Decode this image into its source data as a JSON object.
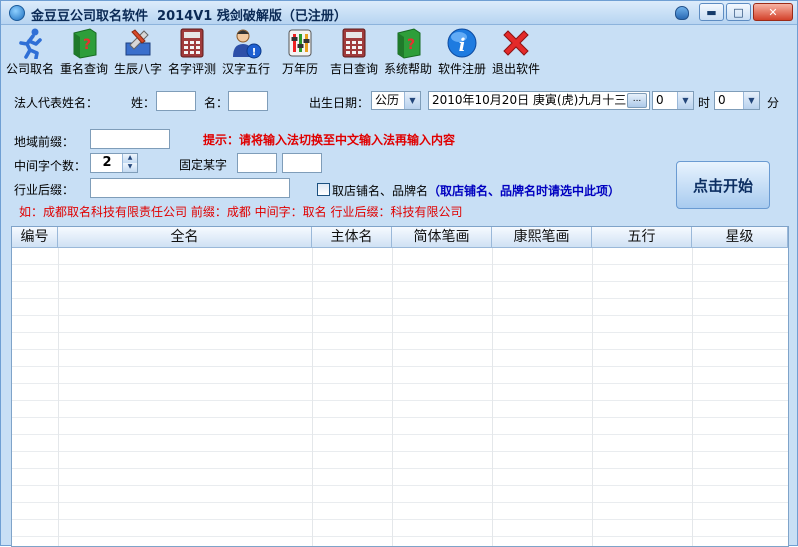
{
  "window": {
    "title": "金豆豆公司取名软件  2014V1 残剑破解版（已注册）",
    "controls": {
      "minimize": "▬",
      "maximize": "□",
      "close": "✕"
    }
  },
  "toolbar": {
    "items": [
      {
        "label": "公司取名",
        "icon": "runner-icon"
      },
      {
        "label": "重名查询",
        "icon": "green-book-icon"
      },
      {
        "label": "生辰八字",
        "icon": "tools-icon"
      },
      {
        "label": "名字评测",
        "icon": "calculator-icon"
      },
      {
        "label": "汉字五行",
        "icon": "person-info-icon"
      },
      {
        "label": "万年历",
        "icon": "calendar-sliders-icon"
      },
      {
        "label": "吉日查询",
        "icon": "calculator-icon"
      },
      {
        "label": "系统帮助",
        "icon": "help-book-icon"
      },
      {
        "label": "软件注册",
        "icon": "info-icon"
      },
      {
        "label": "退出软件",
        "icon": "red-x-icon"
      }
    ]
  },
  "form": {
    "legal_rep_label": "法人代表姓名：",
    "surname_label": "姓：",
    "surname_value": "",
    "given_label": "名：",
    "given_value": "",
    "birth_label": "出生日期：",
    "calendar_type": "公历",
    "birth_date": "2010年10月20日 庚寅(虎)九月十三",
    "dots": "...",
    "hour_value": "0",
    "hour_label": "时",
    "minute_value": "0",
    "minute_label": "分",
    "region_prefix_label": "地域前缀：",
    "region_prefix_value": "",
    "hint": "提示：请将输入法切换至中文输入法再输入内容",
    "middle_count_label": "中间字个数：",
    "middle_count_value": "2",
    "fixed_char_label": "固定某字",
    "fixed_char_1": "",
    "fixed_char_2": "",
    "industry_suffix_label": "行业后缀：",
    "industry_suffix_value": "",
    "store_checkbox_label": "取店铺名、品牌名",
    "store_checkbox_note": "（取店铺名、品牌名时请选中此项）",
    "example": "如：成都取名科技有限责任公司   前缀：成都   中间字：取名   行业后缀：科技有限公司",
    "start_button": "点击开始"
  },
  "results_table": {
    "columns": [
      "编号",
      "全名",
      "主体名",
      "简体笔画",
      "康熙笔画",
      "五行",
      "星级"
    ],
    "rows": []
  }
}
